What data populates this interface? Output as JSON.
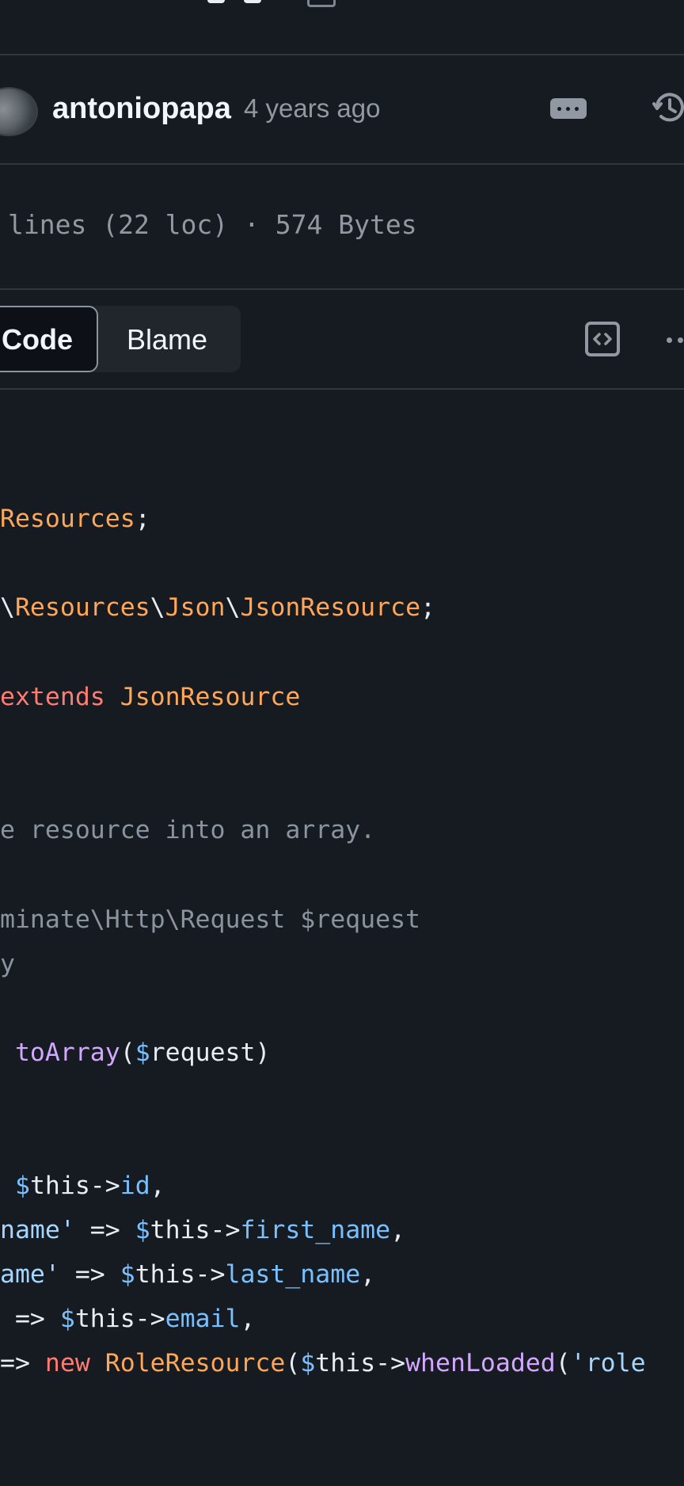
{
  "commit": {
    "author": "antoniopapa",
    "time": "4 years ago"
  },
  "file": {
    "info": "lines (22 loc) · 574 Bytes"
  },
  "tabs": {
    "code": "Code",
    "blame": "Blame"
  },
  "code": {
    "l1": {
      "a": "Resources",
      "b": ";"
    },
    "l2": {
      "a": "\\",
      "b": "Resources",
      "c": "\\",
      "d": "Json",
      "e": "\\",
      "f": "JsonResource",
      "g": ";"
    },
    "l3": {
      "a": "extends",
      "b": " ",
      "c": "JsonResource"
    },
    "l4": "e resource into an array.",
    "l5": "minate\\Http\\Request $request",
    "l6": "y",
    "l7": {
      "a": " ",
      "b": "toArray",
      "c": "(",
      "d": "$",
      "e": "request)"
    },
    "l8": {
      "a": " ",
      "b": "$",
      "c": "this->",
      "d": "id",
      "e": ","
    },
    "l9": {
      "a": "name'",
      "b": " => ",
      "c": "$",
      "d": "this->",
      "e": "first_name",
      "f": ","
    },
    "l10": {
      "a": "ame'",
      "b": " => ",
      "c": "$",
      "d": "this->",
      "e": "last_name",
      "f": ","
    },
    "l11": {
      "a": " => ",
      "b": "$",
      "c": "this->",
      "d": "email",
      "e": ","
    },
    "l12": {
      "a": "=> ",
      "b": "new",
      "c": " ",
      "d": "RoleResource",
      "e": "(",
      "f": "$",
      "g": "this->",
      "h": "whenLoaded",
      "i": "(",
      "j": "'role"
    }
  }
}
